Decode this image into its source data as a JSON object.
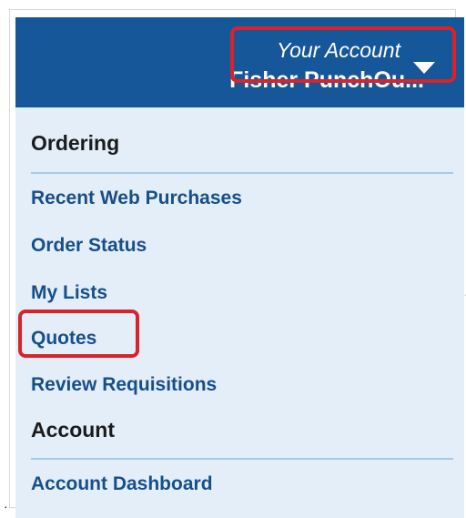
{
  "header": {
    "account_label": "Your Account",
    "account_name": "Fisher PunchOu...",
    "dropdown_icon": "caret-down-icon"
  },
  "sections": [
    {
      "heading": "Ordering",
      "items": [
        {
          "label": "Recent Web Purchases"
        },
        {
          "label": "Order Status"
        },
        {
          "label": "My Lists"
        },
        {
          "label": "Quotes",
          "highlighted": true
        },
        {
          "label": "Review Requisitions"
        }
      ]
    },
    {
      "heading": "Account",
      "items": [
        {
          "label": "Account Dashboard"
        }
      ]
    }
  ],
  "colors": {
    "header_bg": "#155798",
    "menu_bg": "#e3eef9",
    "link": "#174f8a",
    "highlight": "#d9222a",
    "divider": "#a8c8ea"
  }
}
